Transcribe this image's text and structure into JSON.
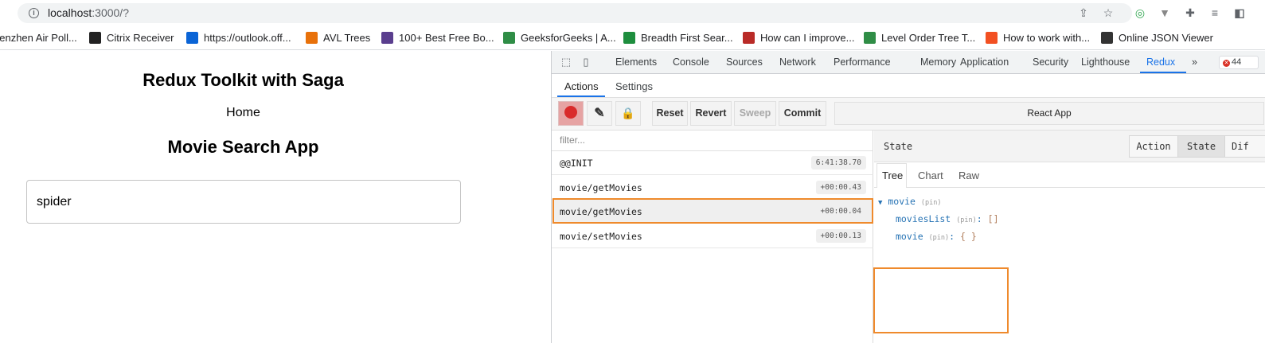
{
  "browser": {
    "url_host": "localhost",
    "url_path": ":3000/?",
    "info_icon": "i"
  },
  "bookmarks": [
    {
      "label": "nenzhen Air Poll...",
      "icon": "globe",
      "color": "#ffffff"
    },
    {
      "label": "Citrix Receiver",
      "icon": "citrix",
      "color": "#222222"
    },
    {
      "label": "https://outlook.off...",
      "icon": "outlook",
      "color": "#0a64d6"
    },
    {
      "label": "AVL Trees",
      "icon": "tree",
      "color": "#e8710a"
    },
    {
      "label": "100+ Best Free Bo...",
      "icon": "book",
      "color": "#5a3e8e"
    },
    {
      "label": "GeeksforGeeks | A...",
      "icon": "gfg",
      "color": "#2f8d46"
    },
    {
      "label": "Breadth First Sear...",
      "icon": "clock",
      "color": "#1e8e3e"
    },
    {
      "label": "How can I improve...",
      "icon": "quora",
      "color": "#b92b27"
    },
    {
      "label": "Level Order Tree T...",
      "icon": "gfg",
      "color": "#2f8d46"
    },
    {
      "label": "How to work with...",
      "icon": "microsoft",
      "color": "#f25022"
    },
    {
      "label": "Online JSON Viewer",
      "icon": "json",
      "color": "#333333"
    }
  ],
  "page": {
    "title": "Redux Toolkit with Saga",
    "home_link": "Home",
    "subtitle": "Movie Search App",
    "search_value": "spider"
  },
  "devtools": {
    "tabs": [
      "Elements",
      "Console",
      "Sources",
      "Network",
      "Performance",
      "Memory",
      "Application",
      "Security",
      "Lighthouse",
      "Redux"
    ],
    "active_tab": "Redux",
    "more": "»",
    "error_count": "44",
    "sub_tabs": [
      "Actions",
      "Settings"
    ],
    "toolbar": {
      "reset": "Reset",
      "revert": "Revert",
      "sweep": "Sweep",
      "commit": "Commit",
      "instance": "React App"
    },
    "filter_placeholder": "filter...",
    "actions": [
      {
        "name": "@@INIT",
        "time": "6:41:38.70"
      },
      {
        "name": "movie/getMovies",
        "time": "+00:00.43"
      },
      {
        "name": "movie/getMovies",
        "time": "+00:00.04"
      },
      {
        "name": "movie/setMovies",
        "time": "+00:00.13"
      }
    ],
    "selected_action_index": 2,
    "state_panel": {
      "title": "State",
      "segments": [
        "Action",
        "State",
        "Dif"
      ],
      "active_segment": "State",
      "view_tabs": [
        "Tree",
        "Chart",
        "Raw"
      ],
      "active_view": "Tree",
      "tree": {
        "root_key": "movie",
        "pin": "(pin)",
        "children": [
          {
            "key": "moviesList",
            "value": "[]"
          },
          {
            "key": "movie",
            "value": "{ }"
          }
        ]
      }
    }
  },
  "colors": {
    "accent": "#1a73e8",
    "highlight": "#ef8a2c",
    "record": "#d92b2b"
  }
}
